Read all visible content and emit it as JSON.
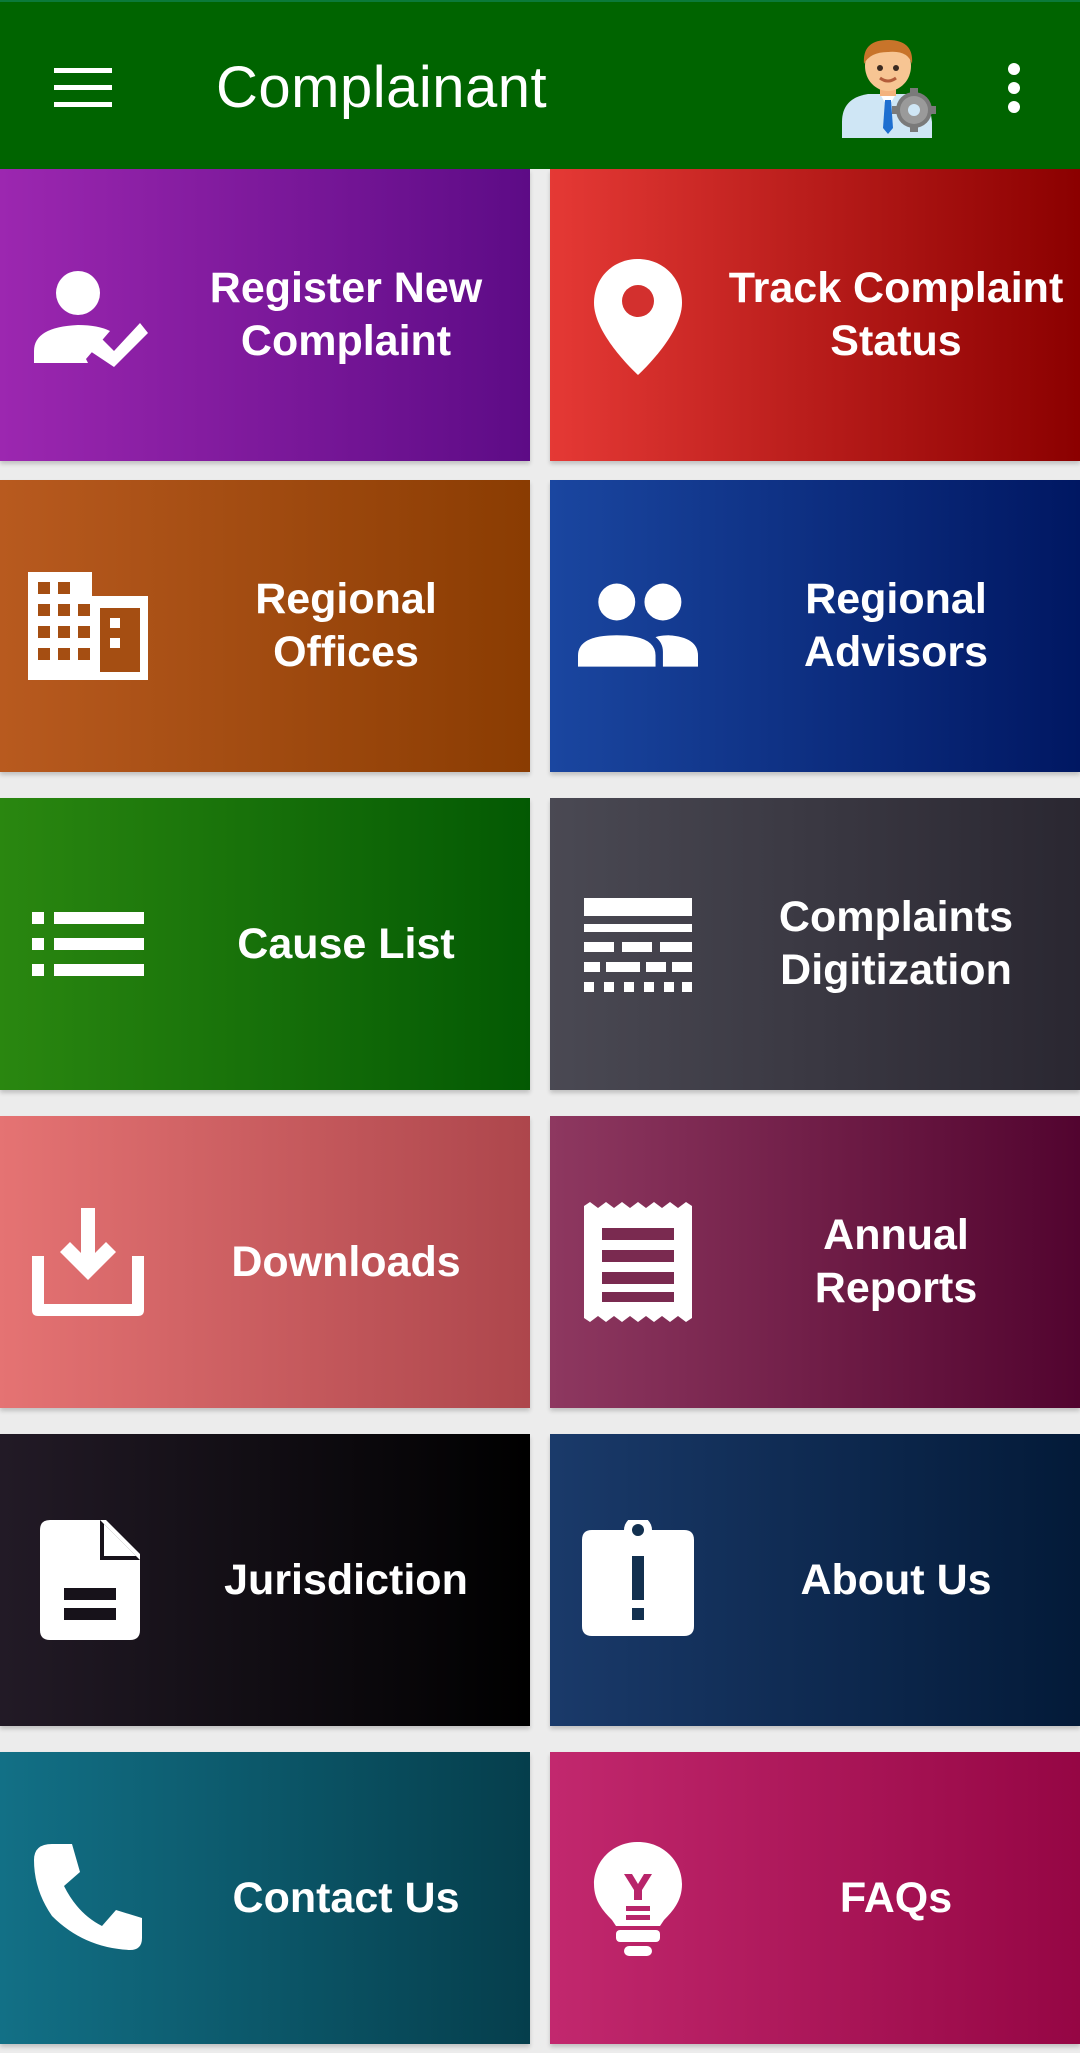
{
  "app_bar": {
    "title": "Complainant",
    "menu_icon": "hamburger-menu-icon",
    "avatar_icon": "user-settings-avatar-icon",
    "more_icon": "more-vert-icon",
    "background": "#006400"
  },
  "tiles": [
    {
      "label": "Register New\nComplaint",
      "icon": "user-check-icon",
      "colors": [
        "#9c27b0",
        "#5d0b86"
      ]
    },
    {
      "label": "Track Complaint\nStatus",
      "icon": "location-pin-icon",
      "colors": [
        "#e53935",
        "#8b0000"
      ]
    },
    {
      "label": "Regional\nOffices",
      "icon": "building-icon",
      "colors": [
        "#b85a1f",
        "#8a3c02"
      ]
    },
    {
      "label": "Regional\nAdvisors",
      "icon": "people-icon",
      "colors": [
        "#1a46a0",
        "#001762"
      ]
    },
    {
      "label": "Cause List",
      "icon": "list-icon",
      "colors": [
        "#2a8710",
        "#035903"
      ]
    },
    {
      "label": "Complaints\nDigitization",
      "icon": "text-lines-icon",
      "colors": [
        "#4a4953",
        "#2a2731"
      ]
    },
    {
      "label": "Downloads",
      "icon": "download-icon",
      "colors": [
        "#e57373",
        "#ad464c"
      ]
    },
    {
      "label": "Annual\nReports",
      "icon": "receipt-icon",
      "colors": [
        "#8e3860",
        "#52042f"
      ]
    },
    {
      "label": "Jurisdiction",
      "icon": "document-icon",
      "colors": [
        "#221a26",
        "#000000"
      ]
    },
    {
      "label": "About Us",
      "icon": "clipboard-alert-icon",
      "colors": [
        "#1a3a6a",
        "#031a38"
      ]
    },
    {
      "label": "Contact Us",
      "icon": "phone-icon",
      "colors": [
        "#127086",
        "#053e4c"
      ]
    },
    {
      "label": "FAQs",
      "icon": "lightbulb-icon",
      "colors": [
        "#c2286e",
        "#950644"
      ]
    }
  ]
}
